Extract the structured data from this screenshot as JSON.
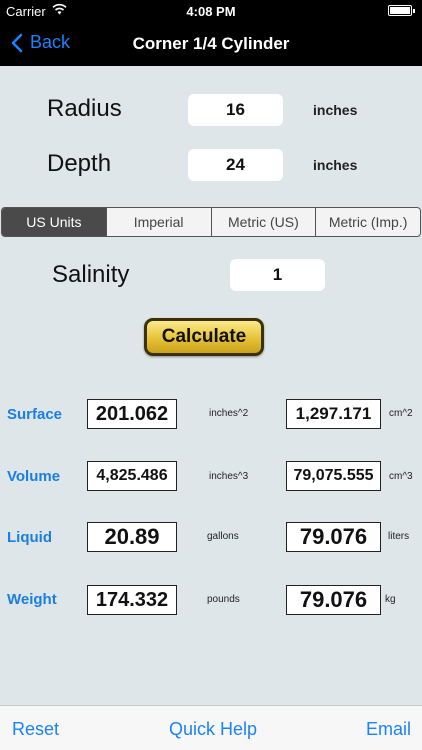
{
  "status": {
    "carrier": "Carrier",
    "time": "4:08 PM"
  },
  "nav": {
    "back_label": "Back",
    "title": "Corner 1/4 Cylinder"
  },
  "inputs": {
    "radius": {
      "label": "Radius",
      "value": "16",
      "unit": "inches"
    },
    "depth": {
      "label": "Depth",
      "value": "24",
      "unit": "inches"
    },
    "salinity": {
      "label": "Salinity",
      "value": "1"
    }
  },
  "units_segments": [
    "US Units",
    "Imperial",
    "Metric (US)",
    "Metric (Imp.)"
  ],
  "selected_segment": "US Units",
  "calculate_label": "Calculate",
  "results": {
    "surface": {
      "label": "Surface",
      "value1": "201.062",
      "unit1": "inches^2",
      "value2": "1,297.171",
      "unit2": "cm^2"
    },
    "volume": {
      "label": "Volume",
      "value1": "4,825.486",
      "unit1": "inches^3",
      "value2": "79,075.555",
      "unit2": "cm^3"
    },
    "liquid": {
      "label": "Liquid",
      "value1": "20.89",
      "unit1": "gallons",
      "value2": "79.076",
      "unit2": "liters"
    },
    "weight": {
      "label": "Weight",
      "value1": "174.332",
      "unit1": "pounds",
      "value2": "79.076",
      "unit2": "kg"
    }
  },
  "toolbar": {
    "reset": "Reset",
    "quick_help": "Quick Help",
    "email": "Email"
  },
  "colors": {
    "accent": "#1a82fb",
    "result_label": "#1a7fe0",
    "background": "#dfe6ea"
  }
}
